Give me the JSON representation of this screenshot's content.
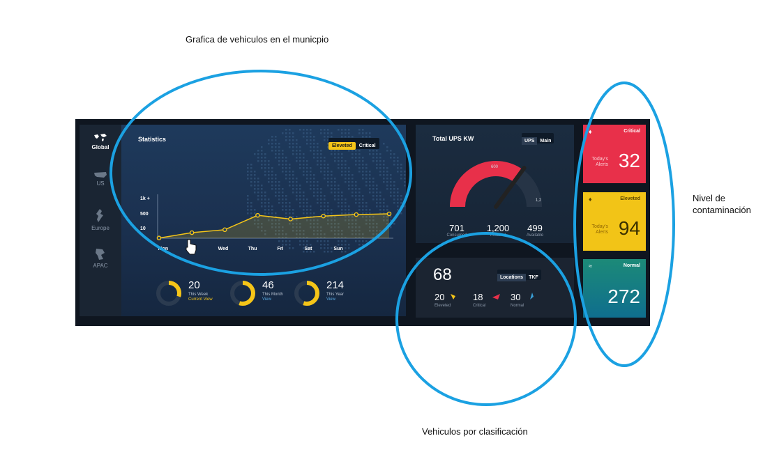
{
  "annotations": {
    "title": "Grafica de vehiculos en el municpio",
    "right_line1": "Nivel de",
    "right_line2": "contaminación",
    "bottom": "Vehiculos por clasificación"
  },
  "nav": {
    "items": [
      {
        "label": "Global",
        "icon": "world-map-icon",
        "active": true
      },
      {
        "label": "US",
        "icon": "us-map-icon",
        "active": false
      },
      {
        "label": "Europe",
        "icon": "europe-map-icon",
        "active": false
      },
      {
        "label": "APAC",
        "icon": "apac-map-icon",
        "active": false
      }
    ]
  },
  "statistics": {
    "title": "Statistics",
    "toggle": {
      "on": "Eleveted",
      "off": "Critical"
    },
    "cursor_icon": "hand-pointer-icon"
  },
  "chart_data": {
    "type": "line",
    "categories": [
      "Mon",
      "Tue",
      "Wed",
      "Thu",
      "Fri",
      "Sat",
      "Sun",
      ""
    ],
    "visible_tick_labels": [
      "Mon",
      "e",
      "Wed",
      "Thu",
      "Fri",
      "Sat",
      "Sun"
    ],
    "yticks": [
      "1k +",
      "500",
      "10"
    ],
    "values": [
      5,
      150,
      230,
      620,
      520,
      600,
      640,
      660
    ],
    "ylim": [
      0,
      1000
    ],
    "color": "#f5c518",
    "grid": false
  },
  "summary": [
    {
      "value": "20",
      "label": "This Week",
      "link": "Current View",
      "fraction": 0.3
    },
    {
      "value": "46",
      "label": "This Month",
      "link": "View",
      "fraction": 0.55
    },
    {
      "value": "214",
      "label": "This Year",
      "link": "View",
      "fraction": 0.55
    }
  ],
  "ups": {
    "title": "Total UPS KW",
    "toggle": {
      "on": "UPS",
      "off": "Main"
    },
    "gauge_tick_top": "600",
    "gauge_tick_right": "1,2",
    "gauge_tick_left": "",
    "gauge_fraction": 0.7,
    "stats": [
      {
        "value": "701",
        "label": "Consumed"
      },
      {
        "value": "1,200",
        "label": "Installed"
      },
      {
        "value": "499",
        "label": "Available"
      }
    ]
  },
  "locations": {
    "total": "68",
    "toggle": {
      "on": "Locations",
      "off": "TKF"
    },
    "items": [
      {
        "value": "20",
        "label": "Eleveted",
        "color": "#f5c518"
      },
      {
        "value": "18",
        "label": "Critical",
        "color": "#e8304a"
      },
      {
        "value": "30",
        "label": "Normal",
        "color": "#3aa0d8"
      }
    ]
  },
  "alerts": [
    {
      "status": "Critical",
      "sub_line1": "Today's",
      "sub_line2": "Alerts",
      "value": "32",
      "icon": "bell-icon",
      "color": "#e8304a"
    },
    {
      "status": "Eleveted",
      "sub_line1": "Today's",
      "sub_line2": "Alerts",
      "value": "94",
      "icon": "bell-icon",
      "color": "#f2c417"
    },
    {
      "status": "Normal",
      "sub_line1": "",
      "sub_line2": "",
      "value": "272",
      "icon": "check-wave-icon",
      "color": "#1c8a78"
    }
  ]
}
